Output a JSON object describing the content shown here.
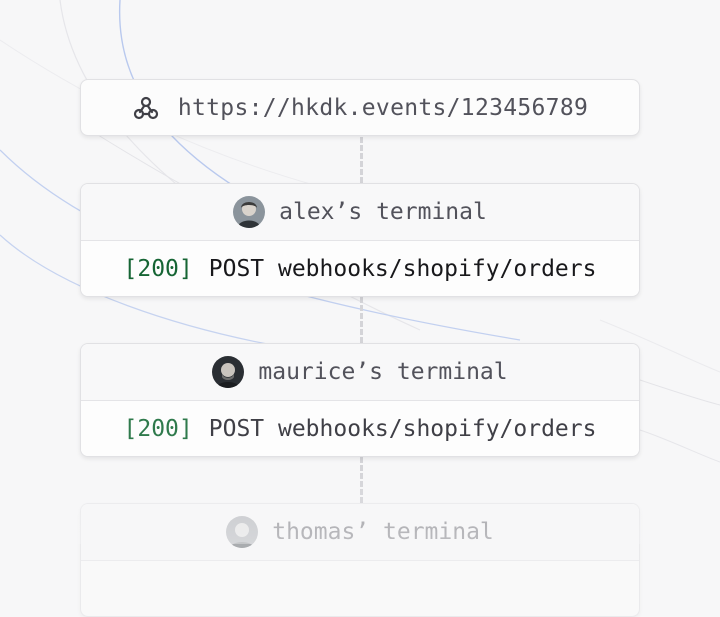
{
  "url_bar": {
    "icon": "webhook-icon",
    "url": "https://hkdk.events/123456789"
  },
  "terminals": [
    {
      "name": "alex’s terminal",
      "avatar": "avatar-alex",
      "status": "[200]",
      "request": "POST webhooks/shopify/orders"
    },
    {
      "name": "maurice’s terminal",
      "avatar": "avatar-maurice",
      "status": "[200]",
      "request": "POST webhooks/shopify/orders"
    },
    {
      "name": "thomas’ terminal",
      "avatar": "avatar-thomas"
    }
  ],
  "colors": {
    "status_ok": "#166534",
    "accent_line": "#b8c8ec",
    "background": "#f7f7f8"
  }
}
